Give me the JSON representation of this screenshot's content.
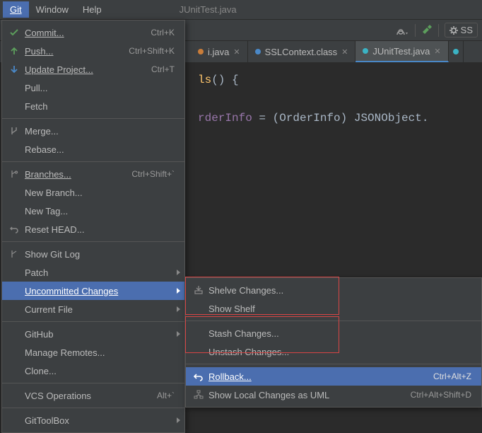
{
  "topbar": {
    "git": "Git",
    "window": "Window",
    "help": "Help",
    "title": "JUnitTest.java"
  },
  "toolbar": {
    "ss_label": "SS"
  },
  "tabs": {
    "t1": "i.java",
    "t2": "SSLContext.class",
    "t3": "JUnitTest.java"
  },
  "editor": {
    "line1a": "ls",
    "line1b": "() {",
    "line2_var": "rderInfo",
    "line2_eq": " = (",
    "line2_type": "OrderInfo",
    "line2_rest": ") JSONObject."
  },
  "menu": {
    "commit": "Commit...",
    "commit_s": "Ctrl+K",
    "push": "Push...",
    "push_s": "Ctrl+Shift+K",
    "update": "Update Project...",
    "update_s": "Ctrl+T",
    "pull": "Pull...",
    "fetch": "Fetch",
    "merge": "Merge...",
    "rebase": "Rebase...",
    "branches": "Branches...",
    "branches_s": "Ctrl+Shift+`",
    "newbranch": "New Branch...",
    "newtag": "New Tag...",
    "reset": "Reset HEAD...",
    "showlog": "Show Git Log",
    "patch": "Patch",
    "uncommitted": "Uncommitted Changes",
    "currentfile": "Current File",
    "github": "GitHub",
    "remotes": "Manage Remotes...",
    "clone": "Clone...",
    "vcsops": "VCS Operations",
    "vcsops_s": "Alt+`",
    "gittoolbox": "GitToolBox"
  },
  "submenu": {
    "shelve": "Shelve Changes...",
    "showshelf": "Show Shelf",
    "stash": "Stash Changes...",
    "unstash": "Unstash Changes...",
    "rollback": "Rollback...",
    "rollback_s": "Ctrl+Alt+Z",
    "showuml": "Show Local Changes as UML",
    "showuml_s": "Ctrl+Alt+Shift+D"
  }
}
